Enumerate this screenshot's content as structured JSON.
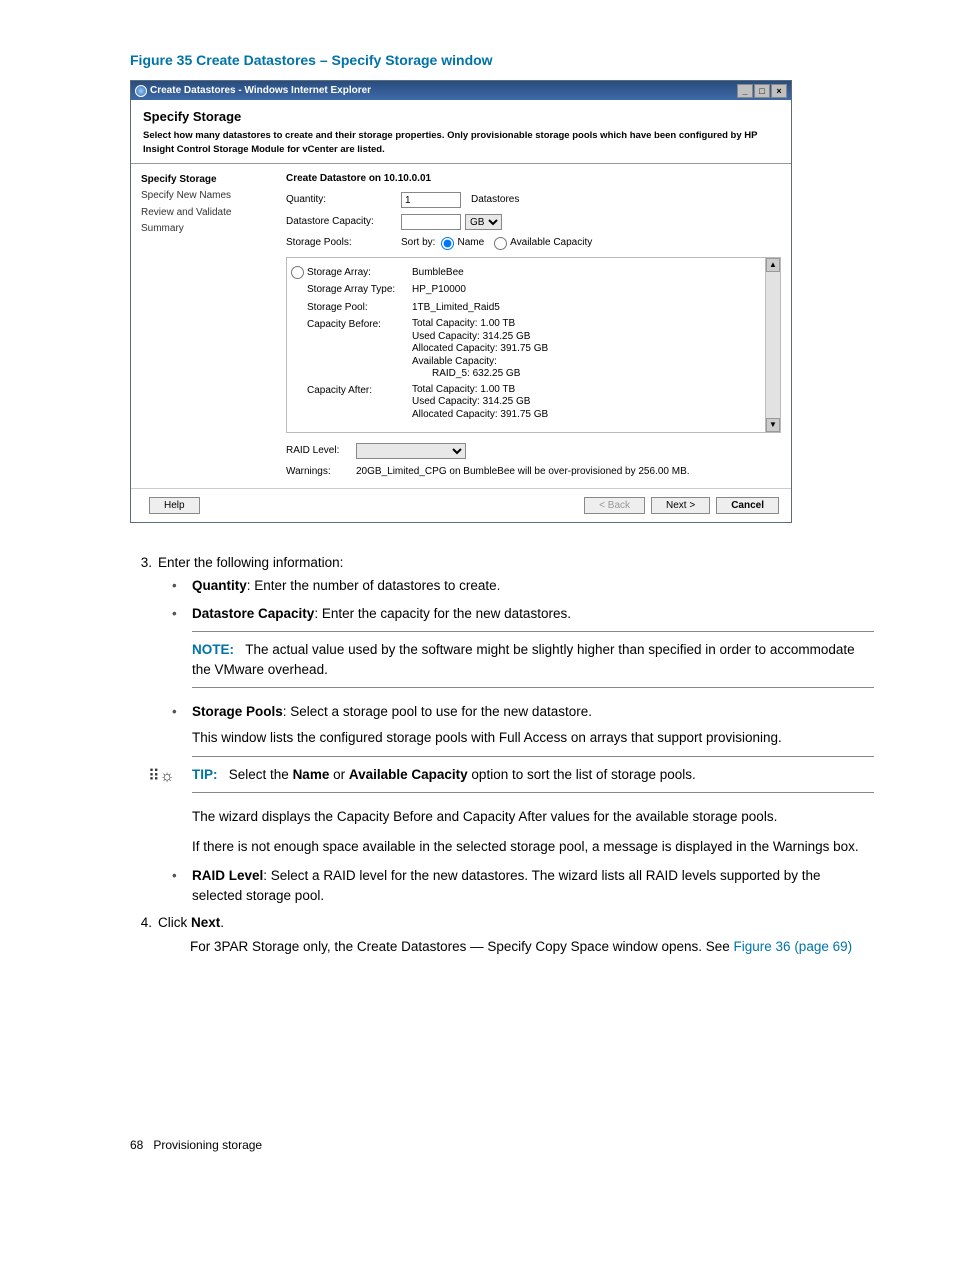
{
  "figure": {
    "caption": "Figure 35 Create Datastores – Specify Storage window"
  },
  "window": {
    "title": "Create Datastores - Windows Internet Explorer",
    "heading": "Specify Storage",
    "subhead": "Select how many datastores to create and their storage properties. Only provisionable storage pools which have been configured by HP Insight Control Storage Module for vCenter are listed.",
    "nav": {
      "i0": "Specify Storage",
      "i1": "Specify New Names",
      "i2": "Review and Validate",
      "i3": "Summary"
    },
    "section": "Create Datastore on 10.10.0.01",
    "labels": {
      "quantity": "Quantity:",
      "datastores": "Datastores",
      "dscap": "Datastore Capacity:",
      "gb": "GB",
      "pools": "Storage Pools:",
      "sortby": "Sort by:",
      "name": "Name",
      "avail": "Available Capacity",
      "storarr": "Storage Array:",
      "storarrtype": "Storage Array Type:",
      "storpool": "Storage Pool:",
      "capbefore": "Capacity Before:",
      "capafter": "Capacity After:",
      "raid": "RAID Level:",
      "warnings": "Warnings:"
    },
    "values": {
      "quantity": "1",
      "storarr": "BumbleBee",
      "storarrtype": "HP_P10000",
      "storpool": "1TB_Limited_Raid5",
      "capbefore1": "Total Capacity: 1.00 TB",
      "capbefore2": "Used Capacity: 314.25 GB",
      "capbefore3": "Allocated Capacity: 391.75 GB",
      "capbefore4": "Available Capacity:",
      "capbefore5": "RAID_5: 632.25 GB",
      "capafter1": "Total Capacity: 1.00 TB",
      "capafter2": "Used Capacity: 314.25 GB",
      "capafter3": "Allocated Capacity: 391.75 GB",
      "warnings": "20GB_Limited_CPG on BumbleBee will be over-provisioned by 256.00 MB."
    },
    "footer": {
      "help": "Help",
      "back": "< Back",
      "next": "Next >",
      "cancel": "Cancel"
    }
  },
  "doc": {
    "s3num": "3.",
    "s3": "Enter the following information:",
    "b1a": "Quantity",
    "b1b": ": Enter the number of datastores to create.",
    "b2a": "Datastore Capacity",
    "b2b": ": Enter the capacity for the new datastores.",
    "notelbl": "NOTE:",
    "note": "The actual value used by the software might be slightly higher than specified in order to accommodate the VMware overhead.",
    "b3a": "Storage Pools",
    "b3b": ": Select a storage pool to use for the new datastore.",
    "b3c": "This window lists the configured storage pools with Full Access on arrays that support provisioning.",
    "tiplbl": "TIP:",
    "tip1": "Select the ",
    "tip2": "Name",
    "tip3": " or ",
    "tip4": "Available Capacity",
    "tip5": " option to sort the list of storage pools.",
    "p1": "The wizard displays the Capacity Before and Capacity After values for the available storage pools.",
    "p2": "If there is not enough space available in the selected storage pool, a message is displayed in the Warnings box.",
    "b4a": "RAID Level",
    "b4b": ": Select a RAID level for the new datastores. The wizard lists all RAID levels supported by the selected storage pool.",
    "s4num": "4.",
    "s4a": "Click ",
    "s4b": "Next",
    "s4c": ".",
    "s4p1": "For 3PAR Storage only, the Create Datastores — Specify Copy Space window opens. See ",
    "s4link": "Figure 36 (page 69)"
  },
  "page": {
    "num": "68",
    "section": "Provisioning storage"
  }
}
